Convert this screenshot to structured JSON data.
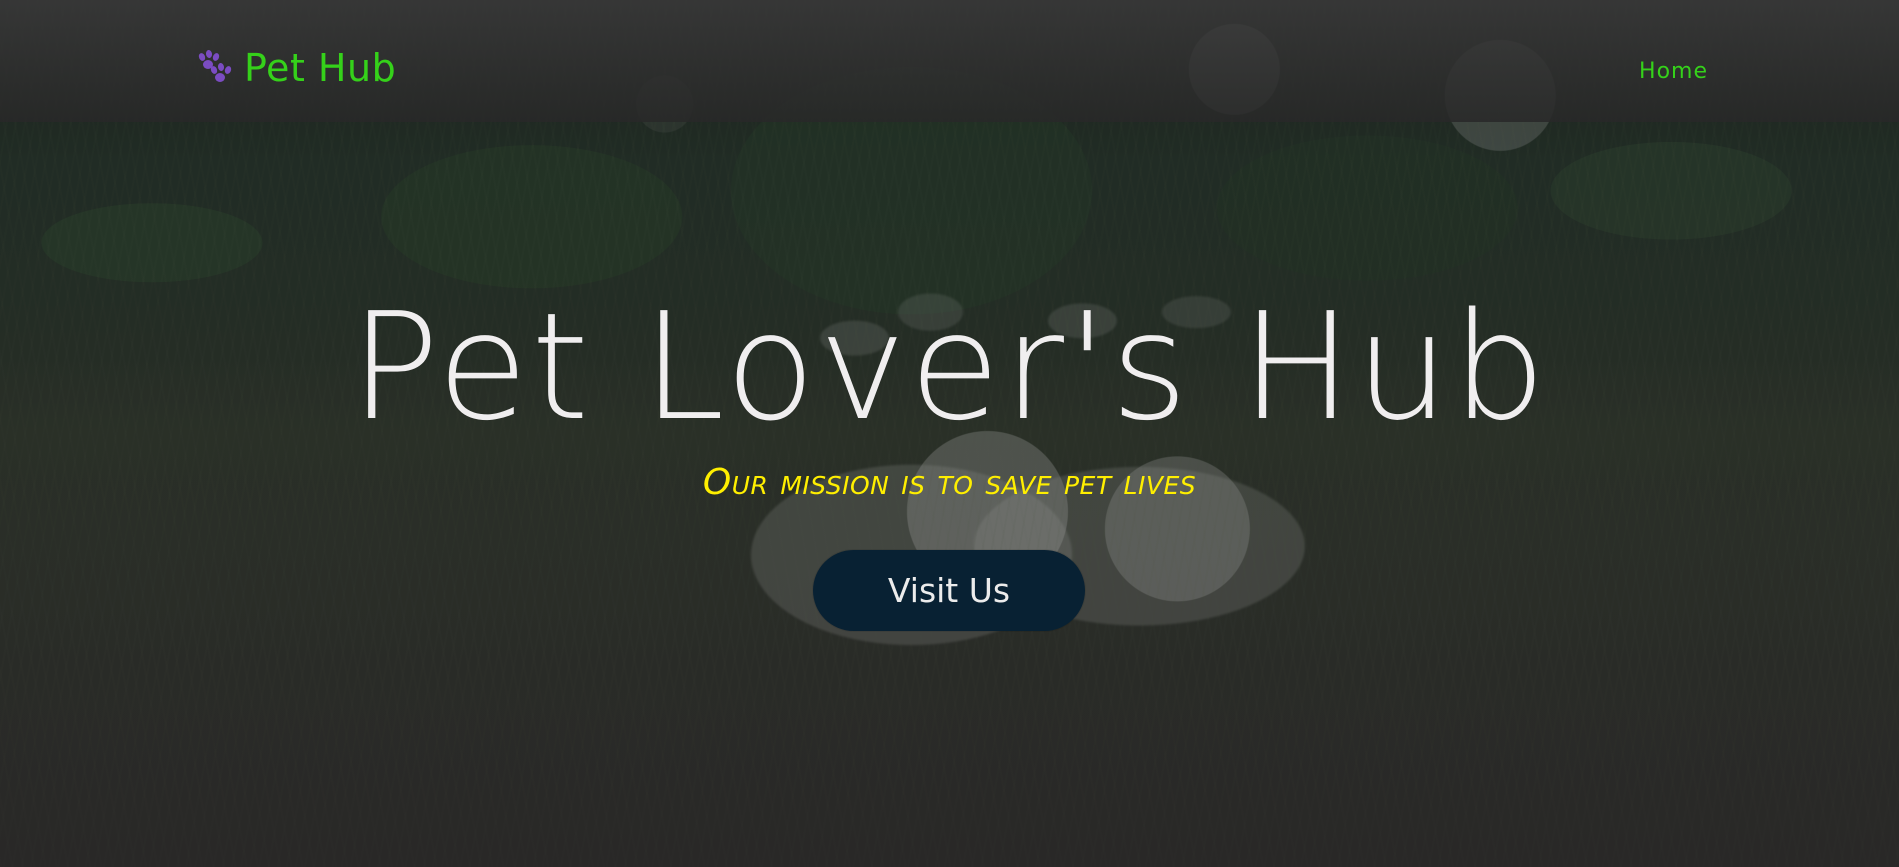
{
  "navbar": {
    "brand_icon": "paw-icon",
    "brand_label": "Pet Hub",
    "home_label": "Home"
  },
  "hero": {
    "title": "Pet Lover's Hub",
    "subtitle": "Our mission is to save pet lives",
    "button_label": "Visit Us"
  },
  "colors": {
    "brand_green": "#35d11a",
    "subtitle_yellow": "#ffef00",
    "button_dark": "#082133",
    "title_white": "#f0eeef"
  }
}
